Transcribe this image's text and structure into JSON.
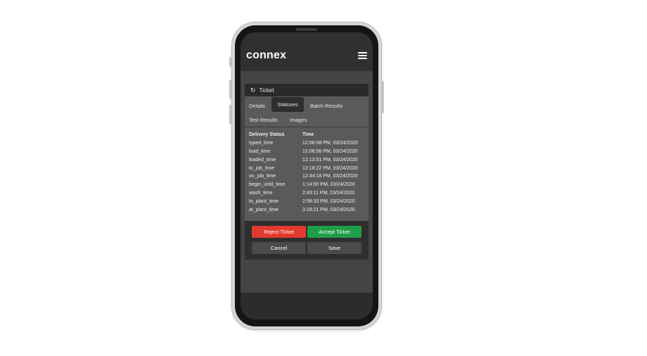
{
  "app": {
    "logo": "connex"
  },
  "ticket": {
    "header_icon": "refresh-icon",
    "header_label": "Ticket"
  },
  "tabs": [
    {
      "label": "Details",
      "active": false
    },
    {
      "label": "Statuses",
      "active": true
    },
    {
      "label": "Batch Results",
      "active": false
    },
    {
      "label": "Test Results",
      "active": false
    },
    {
      "label": "Images",
      "active": false
    }
  ],
  "statuses": {
    "columns": [
      "Delivery Status",
      "Time"
    ],
    "rows": [
      [
        "typed_time",
        "12:08:08 PM, 03/24/2020"
      ],
      [
        "load_time",
        "12:08:58 PM, 03/24/2020"
      ],
      [
        "loaded_time",
        "12:13:51 PM, 03/24/2020"
      ],
      [
        "to_job_time",
        "12:18:22 PM, 03/24/2020"
      ],
      [
        "on_job_time",
        "12:44:18 PM, 03/24/2020"
      ],
      [
        "begin_unld_time",
        "1:14:00 PM, 03/24/2020"
      ],
      [
        "wash_time",
        "2:43:11 PM, 03/24/2020"
      ],
      [
        "to_plant_time",
        "2:58:33 PM, 03/24/2020"
      ],
      [
        "at_plant_time",
        "3:18:21 PM, 03/24/2020"
      ]
    ]
  },
  "actions": {
    "reject_label": "Reject Ticket",
    "accept_label": "Accept Ticket",
    "cancel_label": "Cancel",
    "save_label": "Save"
  },
  "colors": {
    "reject": "#e23a2e",
    "accept": "#1e9e48",
    "header_bg": "#303030",
    "panel_bg": "#5a5a5a"
  }
}
